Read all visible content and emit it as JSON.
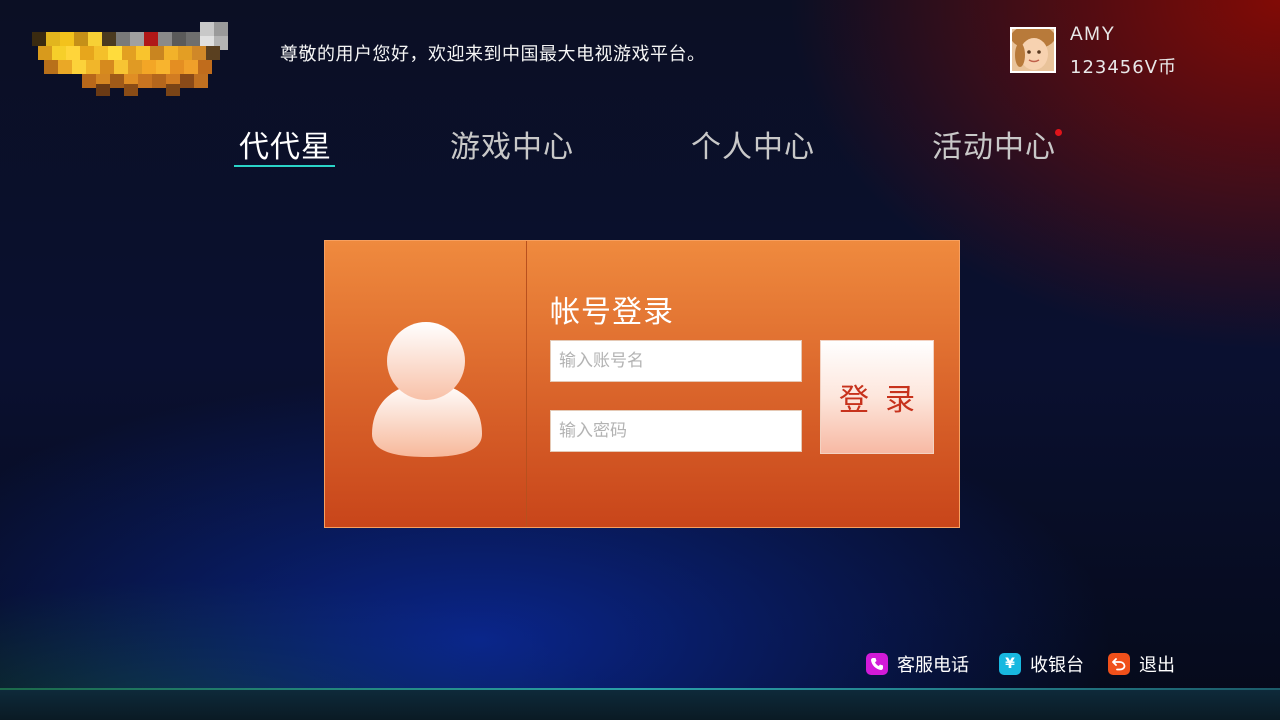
{
  "header": {
    "welcome_text": "尊敬的用户您好，欢迎来到中国最大电视游戏平台。",
    "user": {
      "name": "AMY",
      "balance": "123456V币"
    }
  },
  "nav": {
    "tabs": [
      {
        "label": "代代星",
        "active": true
      },
      {
        "label": "游戏中心",
        "active": false
      },
      {
        "label": "个人中心",
        "active": false
      },
      {
        "label": "活动中心",
        "active": false,
        "badge": "red-dot"
      }
    ]
  },
  "login": {
    "title": "帐号登录",
    "account_placeholder": "输入账号名",
    "password_placeholder": "输入密码",
    "button_label": "登录"
  },
  "footer": {
    "items": [
      {
        "label": "客服电话",
        "icon": "phone-icon",
        "color": "#d21ad8"
      },
      {
        "label": "收银台",
        "icon": "yen-icon",
        "color": "#18b8e0"
      },
      {
        "label": "退出",
        "icon": "back-arrow-icon",
        "color": "#f0501a"
      }
    ]
  },
  "colors": {
    "accent_underline": "#2ad4c8",
    "card_orange": "#e0702e",
    "login_text": "#c7321c",
    "notification_dot": "#e0141a"
  }
}
